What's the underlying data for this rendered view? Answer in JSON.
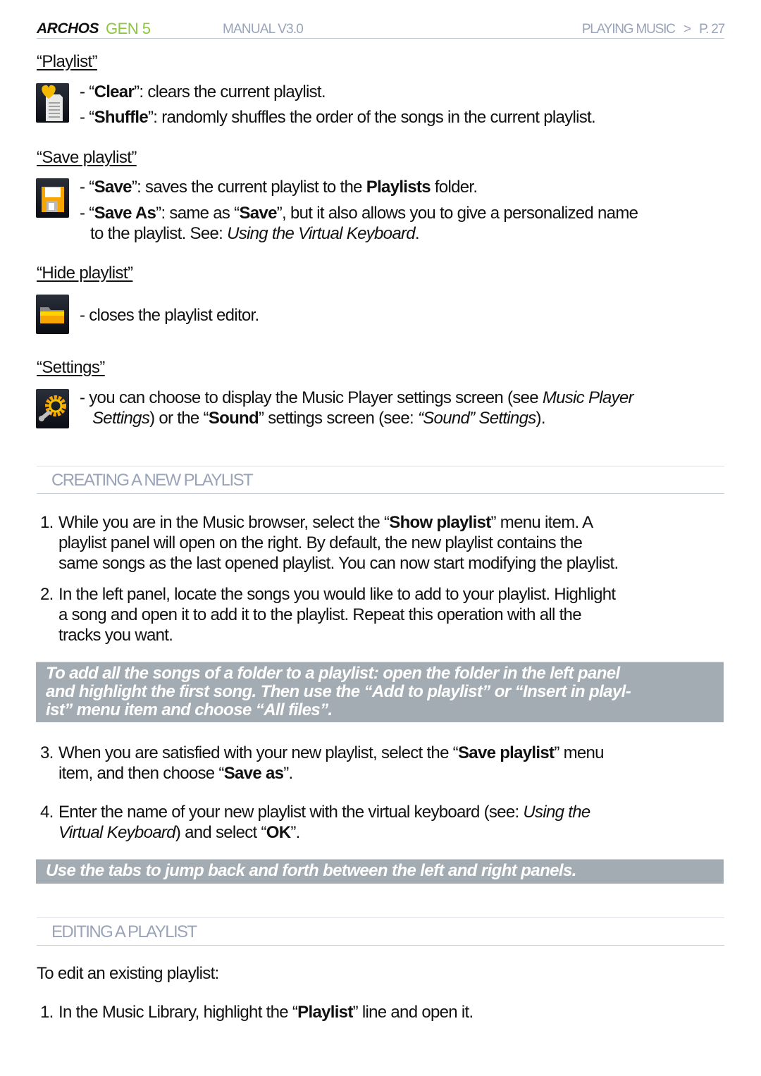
{
  "header": {
    "logo": "ARCHOS",
    "model": "GEN 5",
    "manual": "MANUAL V3.0",
    "section": "PLAYING MUSIC",
    "separator": ">",
    "page": "P. 27"
  },
  "menu_items": [
    {
      "title": "“Playlist”",
      "icon": "playlist-clear-icon",
      "lines": [
        {
          "pre": "- “",
          "bold": "Clear",
          "post": "”: clears the current playlist."
        },
        {
          "pre": "- “",
          "bold": "Shuffle",
          "post": "”: randomly shuffles the order of the songs in the current playlist."
        }
      ]
    },
    {
      "title": "“Save playlist”",
      "icon": "floppy-disk-icon",
      "lines": [
        {
          "pre": "- “",
          "bold": "Save",
          "mid": "”: saves the current playlist to the ",
          "bold2": "Playlists",
          "post": " folder."
        },
        {
          "pre": "- “",
          "bold": "Save As",
          "mid": "”: same as “",
          "bold2": "Save",
          "post": "”, but it also allows you to give a personalized name"
        },
        {
          "pre": "to the playlist. See: ",
          "italic": "Using the Virtual Keyboard",
          "post": "."
        }
      ]
    },
    {
      "title": "“Hide playlist”",
      "icon": "folder-icon",
      "lines": [
        {
          "text": "- closes the playlist editor."
        }
      ]
    },
    {
      "title": "“Settings”",
      "icon": "settings-wrench-gear-icon",
      "lines": [
        {
          "pre": "- you can choose to display the Music Player settings screen (see ",
          "italic": "Music Player"
        },
        {
          "italic": "Settings",
          "mid": ") or the “",
          "bold": "Sound",
          "mid2": "” settings screen (see: ",
          "italic2": "“Sound” Settings",
          "post": ")."
        }
      ]
    }
  ],
  "sections": {
    "creating": {
      "heading": "CREATING A NEW PLAYLIST",
      "steps": [
        {
          "num": "1.",
          "lines": [
            {
              "pre": "While you are in the Music browser, select the “",
              "bold": "Show playlist",
              "post": "” menu item. A"
            },
            {
              "text": "playlist panel will open on the right. By default, the new playlist contains the"
            },
            {
              "text": "same songs as the last opened playlist. You can now start modifying the playlist."
            }
          ]
        },
        {
          "num": "2.",
          "lines": [
            {
              "text": "In the left panel, locate the songs you would like to add to your playlist. Highlight"
            },
            {
              "text": "a song and open it to add it to the playlist. Repeat this operation with all the"
            },
            {
              "text": "tracks you want."
            }
          ]
        },
        {
          "num": "3.",
          "lines": [
            {
              "pre": "When you are satisfied with your new playlist, select the “",
              "bold": "Save playlist",
              "post": "” menu"
            },
            {
              "pre": "item, and then choose “",
              "bold": "Save as",
              "post": "”."
            }
          ]
        },
        {
          "num": "4.",
          "lines": [
            {
              "pre": "Enter the name of your new playlist with the virtual keyboard (see: ",
              "italic": "Using the"
            },
            {
              "italic": "Virtual Keyboard",
              "mid": ") and select “",
              "bold": "OK",
              "post": "”."
            }
          ]
        }
      ],
      "note1": [
        "To add all the songs of a folder to a playlist: open the folder in the left panel",
        "and highlight the first song. Then use the “Add to playlist” or “Insert in playl-",
        "ist” menu item and choose “All files”."
      ],
      "note2": "Use the tabs to jump back and forth between the left and right panels."
    },
    "editing": {
      "heading": "EDITING A PLAYLIST",
      "intro": "To edit an existing playlist:",
      "steps": [
        {
          "num": "1.",
          "pre": "In the Music Library, highlight the “",
          "bold": "Playlist",
          "post": "” line and open it."
        }
      ]
    }
  }
}
